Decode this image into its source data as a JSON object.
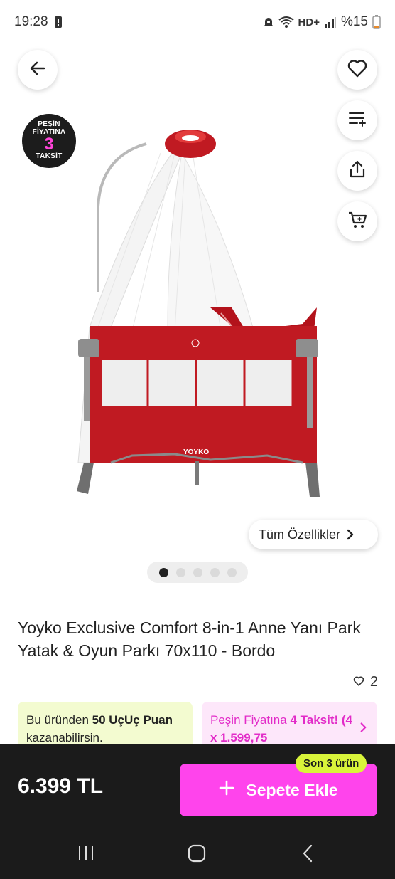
{
  "status_bar": {
    "time": "19:28",
    "battery_text": "%15",
    "network_label": "HD+"
  },
  "badge": {
    "line1": "PEŞİN",
    "line2": "FİYATINA",
    "line3": "3",
    "line4": "TAKSİT"
  },
  "brand_on_product": "YOYKO",
  "features_link": "Tüm Özellikler",
  "pagination": {
    "total": 5,
    "active": 1
  },
  "product": {
    "title": "Yoyko Exclusive Comfort 8-in-1 Anne Yanı Park Yatak & Oyun Parkı 70x110 - Bordo",
    "likes": "2"
  },
  "points_card": {
    "text_prefix": "Bu üründen ",
    "points": "50 UçUç Puan",
    "text_suffix": " kazanabilirsin."
  },
  "installment_card": {
    "prefix": "Peşin Fiyatına ",
    "highlight": "4 Taksit!",
    "suffix": " (4 x 1.599,75"
  },
  "bottom_bar": {
    "price": "6.399 TL",
    "add_to_cart": "Sepete Ekle",
    "stock_tag": "Son 3 ürün"
  },
  "colors": {
    "accent_pink": "#ff44ec",
    "lime": "#d9f43a",
    "product_red": "#c01a22",
    "dark": "#1b1b1b"
  },
  "icons": {
    "back": "arrow-left-icon",
    "favorite": "heart-icon",
    "add_to_list": "playlist-add-icon",
    "share": "share-icon",
    "cart": "cart-plus-icon",
    "chevron": "chevron-right-icon",
    "plus": "plus-icon"
  }
}
